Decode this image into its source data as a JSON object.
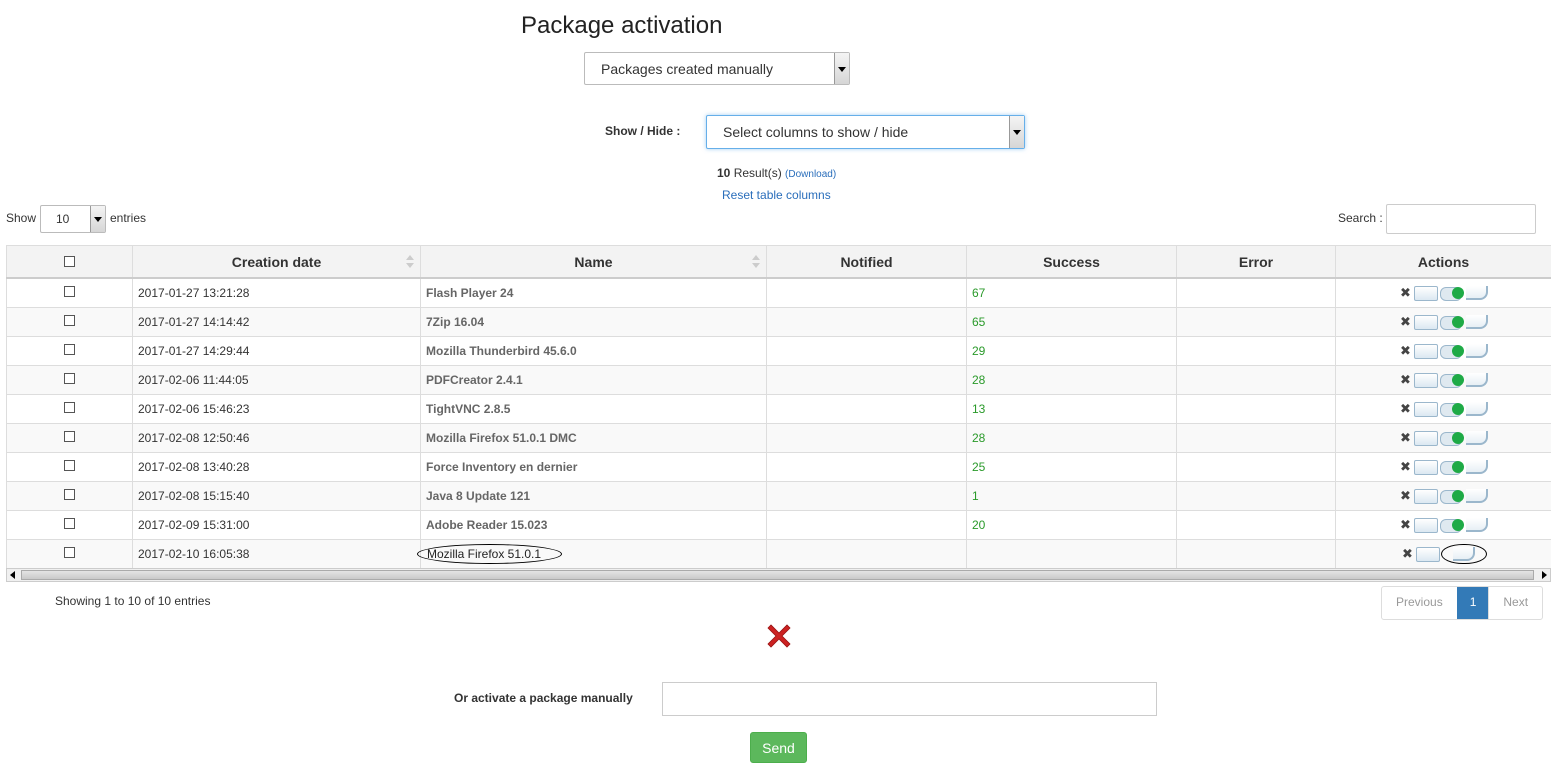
{
  "title": "Package activation",
  "package_filter": {
    "selected": "Packages created manually"
  },
  "columns": {
    "label": "Show / Hide :",
    "selected": "Select columns to show / hide"
  },
  "results": {
    "count": "10",
    "suffix": " Result(s) ",
    "download": "(Download)"
  },
  "reset_link": "Reset table columns",
  "length": {
    "show": "Show",
    "value": "10",
    "entries": "entries"
  },
  "search": {
    "label": "Search :",
    "value": ""
  },
  "table": {
    "headers": [
      "",
      "Creation date",
      "Name",
      "Notified",
      "Success",
      "Error",
      "Actions"
    ],
    "rows": [
      {
        "date": "2017-01-27 13:21:28",
        "name": "Flash Player 24",
        "notified": "",
        "success": "67",
        "error": ""
      },
      {
        "date": "2017-01-27 14:14:42",
        "name": "7Zip 16.04",
        "notified": "",
        "success": "65",
        "error": ""
      },
      {
        "date": "2017-01-27 14:29:44",
        "name": "Mozilla Thunderbird 45.6.0",
        "notified": "",
        "success": "29",
        "error": ""
      },
      {
        "date": "2017-02-06 11:44:05",
        "name": "PDFCreator 2.4.1",
        "notified": "",
        "success": "28",
        "error": ""
      },
      {
        "date": "2017-02-06 15:46:23",
        "name": "TightVNC 2.8.5",
        "notified": "",
        "success": "13",
        "error": ""
      },
      {
        "date": "2017-02-08 12:50:46",
        "name": "Mozilla Firefox 51.0.1 DMC",
        "notified": "",
        "success": "28",
        "error": ""
      },
      {
        "date": "2017-02-08 13:40:28",
        "name": "Force Inventory en dernier",
        "notified": "",
        "success": "25",
        "error": ""
      },
      {
        "date": "2017-02-08 15:15:40",
        "name": "Java 8 Update 121",
        "notified": "",
        "success": "1",
        "error": ""
      },
      {
        "date": "2017-02-09 15:31:00",
        "name": "Adobe Reader 15.023",
        "notified": "",
        "success": "20",
        "error": ""
      },
      {
        "date": "2017-02-10 16:05:38",
        "name": "Mozilla Firefox 51.0.1",
        "notified": "",
        "success": "",
        "error": ""
      }
    ]
  },
  "info": "Showing 1 to 10 of 10 entries",
  "pager": {
    "previous": "Previous",
    "page": "1",
    "next": "Next"
  },
  "manual": {
    "label": "Or activate a package manually",
    "value": "",
    "send": "Send"
  },
  "colors": {
    "success": "#2a9a2a",
    "send_bg": "#5cb85c",
    "page_active": "#337ab7",
    "error_x": "#cc2222"
  }
}
